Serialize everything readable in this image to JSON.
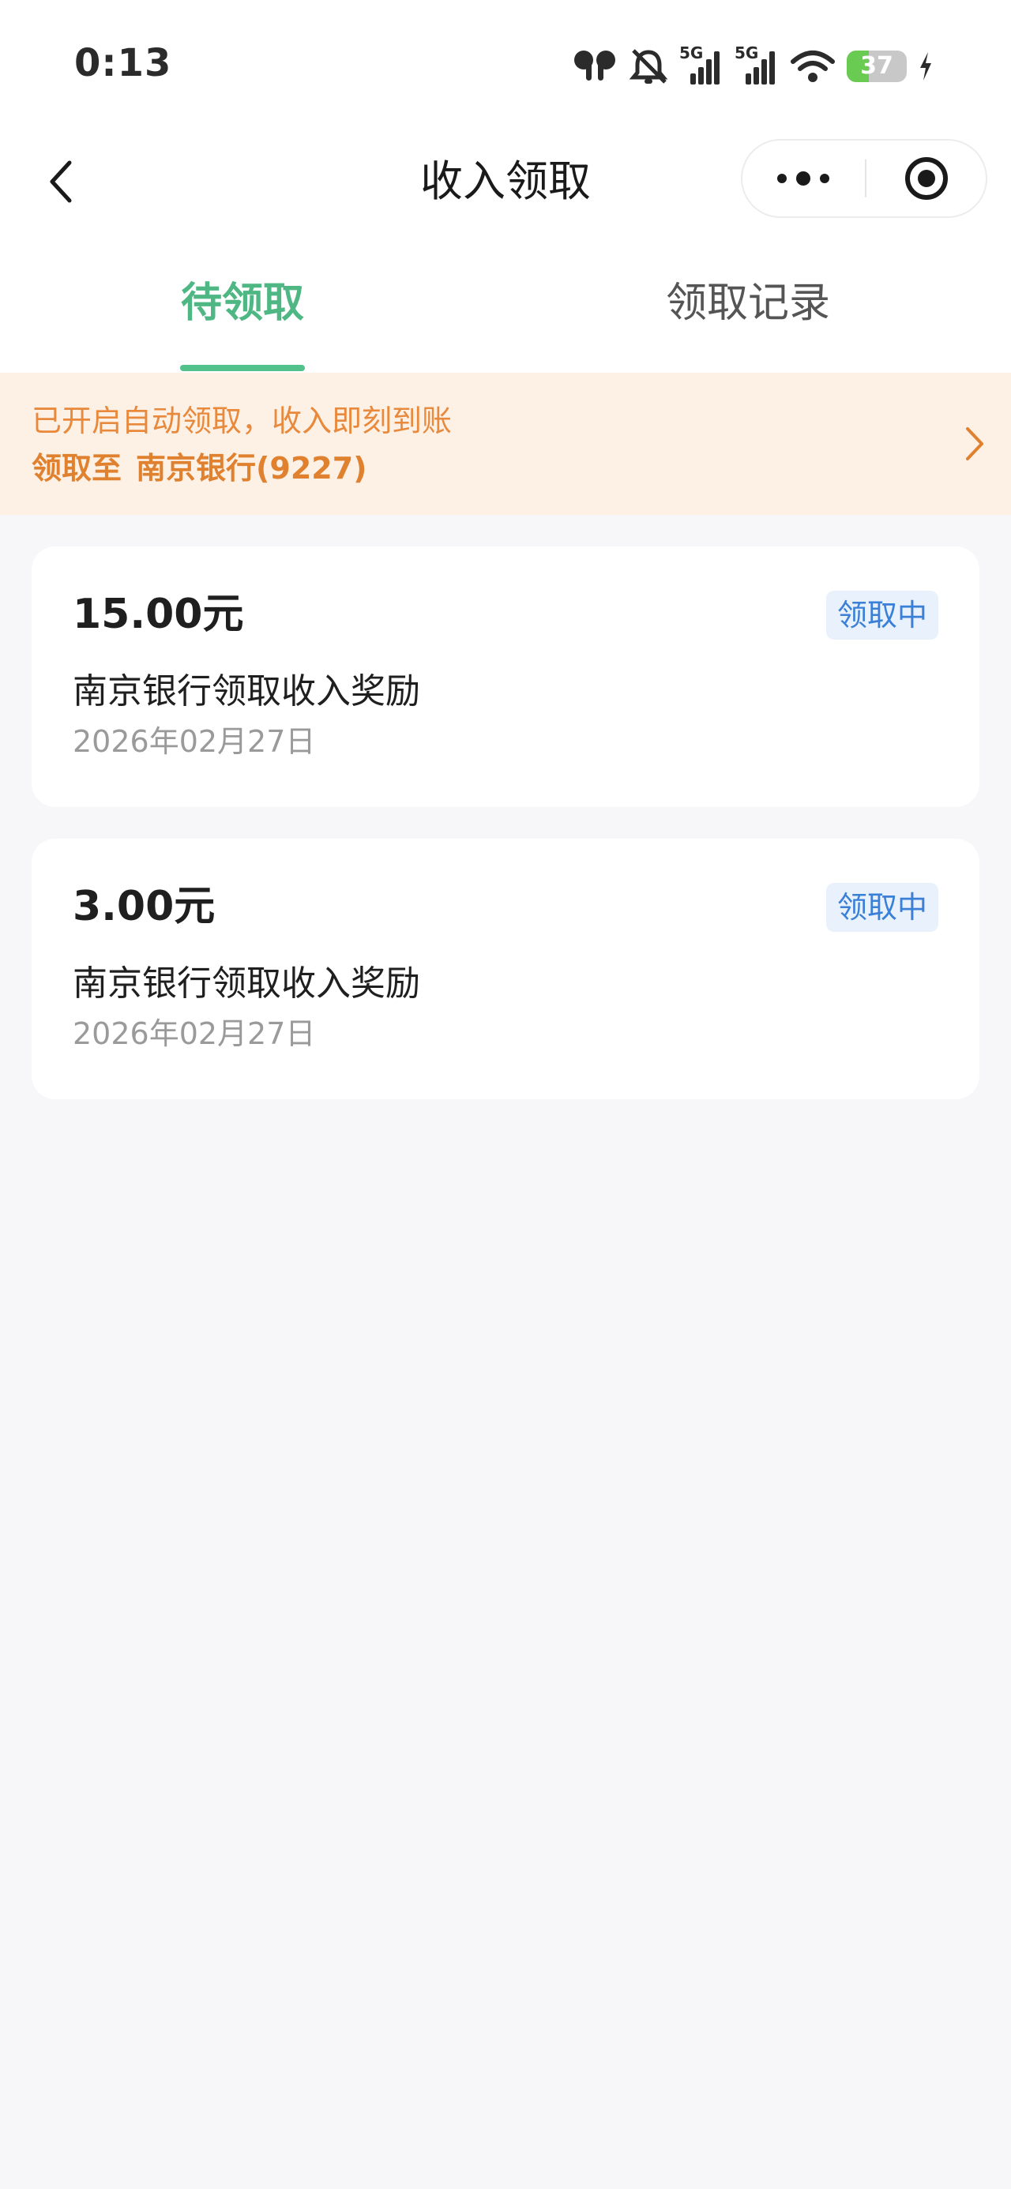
{
  "status_bar": {
    "time": "0:13",
    "signal_1_label": "5G",
    "signal_2_label": "5G",
    "battery_level": "37",
    "icons": [
      "earbuds-icon",
      "bell-muted-icon",
      "signal-5g-icon",
      "signal-5g-icon",
      "wifi-icon",
      "battery-icon",
      "charging-bolt-icon"
    ]
  },
  "nav": {
    "title": "收入领取",
    "icons": [
      "back-chevron-icon",
      "more-dots-icon",
      "close-target-icon"
    ]
  },
  "tabs": {
    "pending": "待领取",
    "records": "领取记录",
    "active": "pending"
  },
  "notice": {
    "line1": "已开启自动领取，收入即刻到账",
    "prefix": "领取至",
    "bank": "南京银行(9227)"
  },
  "records": [
    {
      "amount": "15.00元",
      "status": "领取中",
      "description": "南京银行领取收入奖励",
      "date": "2026年02月27日"
    },
    {
      "amount": "3.00元",
      "status": "领取中",
      "description": "南京银行领取收入奖励",
      "date": "2026年02月27日"
    }
  ],
  "colors": {
    "accent_green": "#52c18c",
    "notice_bg": "#fdf1e6",
    "notice_text": "#e8893c",
    "badge_bg": "#e8f1fc",
    "badge_text": "#3a80d6",
    "page_bg": "#f7f7f9",
    "battery_green": "#6acb53"
  }
}
